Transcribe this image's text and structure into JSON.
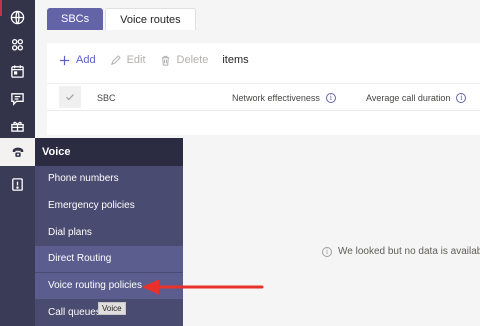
{
  "tabs": [
    {
      "label": "SBCs",
      "active": true
    },
    {
      "label": "Voice routes",
      "active": false
    }
  ],
  "toolbar": {
    "add_label": "Add",
    "edit_label": "Edit",
    "delete_label": "Delete",
    "items_label": "items"
  },
  "table": {
    "columns": [
      "SBC",
      "Network effectiveness",
      "Average call duration"
    ]
  },
  "empty_message": "We looked but no data is available",
  "flyout": {
    "header": "Voice",
    "items": [
      "Phone numbers",
      "Emergency policies",
      "Dial plans",
      "Direct Routing",
      "Voice routing policies",
      "Call queues"
    ]
  },
  "tooltip": "Voice",
  "colors": {
    "accent": "#6264a7",
    "rail": "#33344a",
    "arrow": "#e8312a"
  },
  "rail_icons": [
    "globe-icon",
    "users-icon",
    "calendar-icon",
    "chat-icon",
    "apps-icon",
    "phone-icon",
    "alert-icon",
    "analytics-icon",
    "settings-icon",
    "list-icon",
    "skype-icon",
    "dashboard-icon"
  ]
}
